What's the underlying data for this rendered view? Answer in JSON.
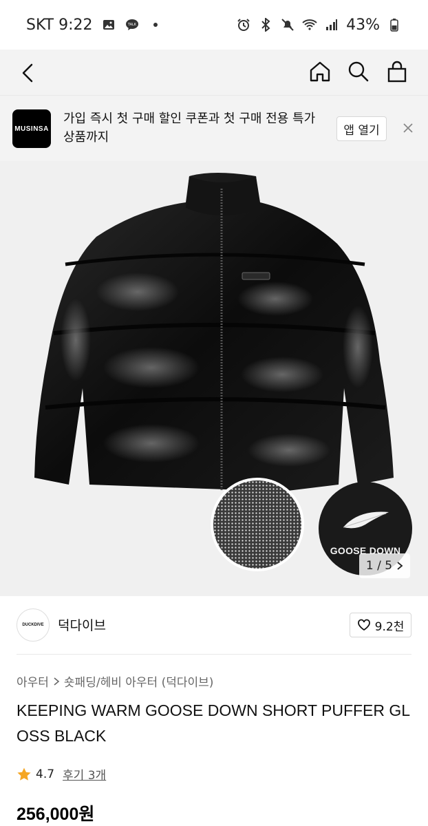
{
  "status_bar": {
    "carrier_time": "SKT 9:22",
    "battery": "43%"
  },
  "header": {
    "icons": [
      "back-icon",
      "home-icon",
      "search-icon",
      "cart-icon"
    ]
  },
  "banner": {
    "logo_text": "MUSINSA",
    "message": "가입 즉시 첫 구매 할인 쿠폰과 첫 구매 전용 특가 상품까지",
    "open_app_label": "앱 열기"
  },
  "gallery": {
    "swatch_label": "GOOSE DOWN",
    "counter": "1 / 5"
  },
  "brand": {
    "logo_text": "DUCKDIVE",
    "name": "덕다이브",
    "likes": "9.2천"
  },
  "product": {
    "breadcrumb_1": "아우터",
    "breadcrumb_2": "숏패딩/헤비 아우터 (덕다이브)",
    "title": "KEEPING WARM GOOSE DOWN SHORT PUFFER GLOSS BLACK",
    "rating": "4.7",
    "reviews": "후기 3개",
    "price": "256,000원"
  },
  "colors": {
    "accent_star": "#f5a623",
    "header_bg": "#f3f3f3"
  }
}
